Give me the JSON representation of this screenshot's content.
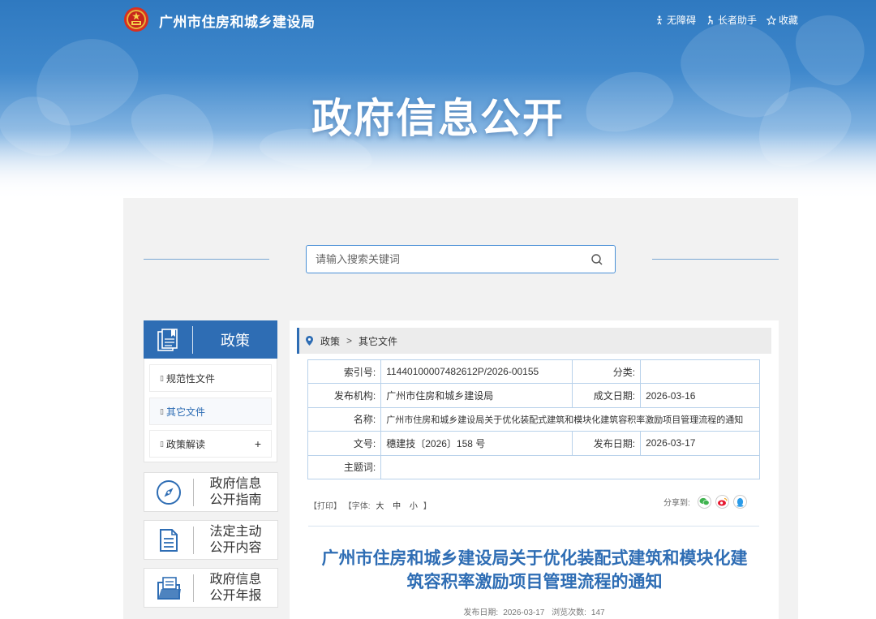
{
  "header": {
    "site_title": "广州市住房和城乡建设局",
    "links": [
      {
        "label": "无障碍",
        "icon": "accessibility-icon"
      },
      {
        "label": "长者助手",
        "icon": "elder-helper-icon"
      },
      {
        "label": "收藏",
        "icon": "star-icon"
      }
    ],
    "hero_title": "政府信息公开"
  },
  "search": {
    "placeholder": "请输入搜索关键词"
  },
  "sidebar": {
    "head_label": "政策",
    "items": [
      {
        "label": "规范性文件",
        "active": false
      },
      {
        "label": "其它文件",
        "active": true
      },
      {
        "label": "政策解读",
        "expandable": true,
        "expand_symbol": "+"
      }
    ],
    "cards": [
      {
        "line1": "政府信息",
        "line2": "公开指南",
        "icon": "compass-icon"
      },
      {
        "line1": "法定主动",
        "line2": "公开内容",
        "icon": "document-list-icon"
      },
      {
        "line1": "政府信息",
        "line2": "公开年报",
        "icon": "report-folder-icon"
      }
    ]
  },
  "breadcrumb": {
    "items": [
      "政策",
      "其它文件"
    ],
    "separator": ">"
  },
  "meta": {
    "index_label": "索引号:",
    "index_value": "11440100007482612P/2026-00155",
    "category_label": "分类:",
    "category_value": "",
    "publisher_label": "发布机构:",
    "publisher_value": "广州市住房和城乡建设局",
    "created_label": "成文日期:",
    "created_value": "2026-03-16",
    "name_label": "名称:",
    "name_value": "广州市住房和城乡建设局关于优化装配式建筑和模块化建筑容积率激励项目管理流程的通知",
    "docno_label": "文号:",
    "docno_value": "穗建技〔2026〕158 号",
    "published_label": "发布日期:",
    "published_value": "2026-03-17",
    "subject_label": "主题词:",
    "subject_value": ""
  },
  "tools": {
    "print": "【打印】",
    "font_label": "【字体:",
    "large": "大",
    "medium": "中",
    "small": "小",
    "close": "】"
  },
  "share": {
    "label": "分享到:",
    "targets": [
      "wechat-icon",
      "weibo-icon",
      "qq-icon"
    ]
  },
  "article": {
    "title_line1": "广州市住房和城乡建设局关于优化装配式建筑和模块化建",
    "title_line2": "筑容积率激励项目管理流程的通知",
    "publish_label": "发布日期:",
    "publish_date": "2026-03-17",
    "views_label": "浏览次数:",
    "views": "147"
  },
  "colors": {
    "primary": "#2e6db4",
    "banner_top": "#2f79c0",
    "panel_bg": "#f2f2f2",
    "table_border": "#b8d1ea"
  }
}
